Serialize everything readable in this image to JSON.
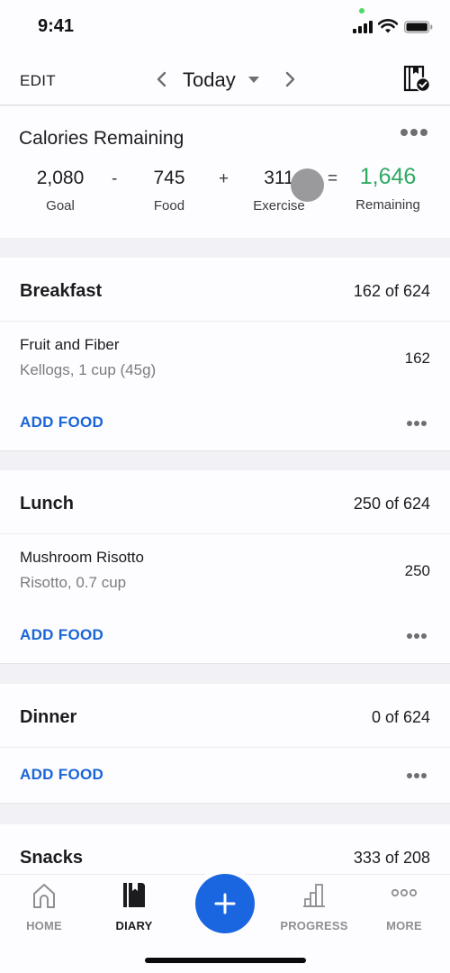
{
  "status_bar": {
    "time": "9:41",
    "icons": [
      "camera-in-use-dot",
      "cellular-signal-icon",
      "wifi-icon",
      "battery-icon"
    ]
  },
  "nav": {
    "edit_label": "EDIT",
    "title": "Today",
    "icons": [
      "chevron-left-icon",
      "caret-down-icon",
      "chevron-right-icon",
      "diary-complete-icon"
    ]
  },
  "calories": {
    "title": "Calories Remaining",
    "goal": {
      "value": "2,080",
      "label": "Goal"
    },
    "op_minus": "-",
    "food": {
      "value": "745",
      "label": "Food"
    },
    "op_plus": "+",
    "exercise": {
      "value": "311",
      "label": "Exercise"
    },
    "op_equals": "=",
    "remaining": {
      "value": "1,646",
      "label": "Remaining"
    },
    "remaining_color": "#2eaa63"
  },
  "meals": [
    {
      "name": "Breakfast",
      "calories": "162 of 624",
      "foods": [
        {
          "name": "Fruit and Fiber",
          "desc": "Kellogs, 1 cup (45g)",
          "calories": "162"
        }
      ],
      "add_label": "ADD FOOD"
    },
    {
      "name": "Lunch",
      "calories": "250 of 624",
      "foods": [
        {
          "name": "Mushroom Risotto",
          "desc": "Risotto, 0.7 cup",
          "calories": "250"
        }
      ],
      "add_label": "ADD FOOD"
    },
    {
      "name": "Dinner",
      "calories": "0 of 624",
      "foods": [],
      "add_label": "ADD FOOD"
    },
    {
      "name": "Snacks",
      "calories": "333 of 208",
      "foods": []
    }
  ],
  "tabbar": {
    "tabs": [
      {
        "label": "HOME",
        "icon": "home-icon",
        "active": false
      },
      {
        "label": "DIARY",
        "icon": "diary-icon",
        "active": true
      },
      {
        "label": "PROGRESS",
        "icon": "progress-icon",
        "active": false
      },
      {
        "label": "MORE",
        "icon": "more-icon",
        "active": false
      }
    ],
    "fab_icon": "plus-icon"
  },
  "colors": {
    "accent_blue": "#1a66e0",
    "link_blue": "#1a66d6",
    "remaining_green": "#2eaa63",
    "background": "#f2f1f6"
  }
}
